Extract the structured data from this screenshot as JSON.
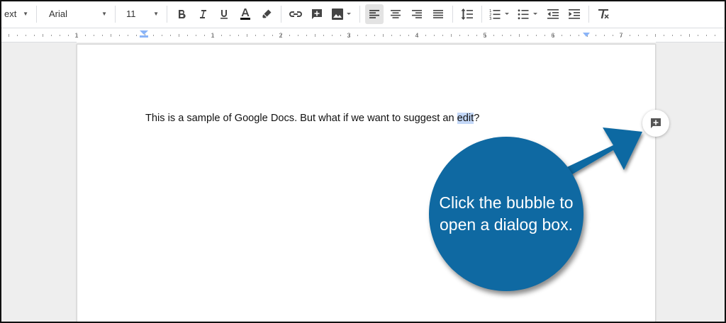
{
  "toolbar": {
    "style_select": "ext",
    "font_select": "Arial",
    "size_select": "11"
  },
  "ruler": {
    "numbers": [
      "1",
      "1",
      "2",
      "3",
      "4",
      "5",
      "6",
      "7"
    ]
  },
  "document": {
    "text_before": "This is a sample of Google Docs. But what if we want to suggest an ",
    "highlighted": "edit",
    "text_after": "?"
  },
  "callout": {
    "text": "Click the bubble to open a dialog box."
  },
  "colors": {
    "callout": "#0f69a2",
    "highlight": "#c3d7f7",
    "text_color_bar": "#111111"
  }
}
